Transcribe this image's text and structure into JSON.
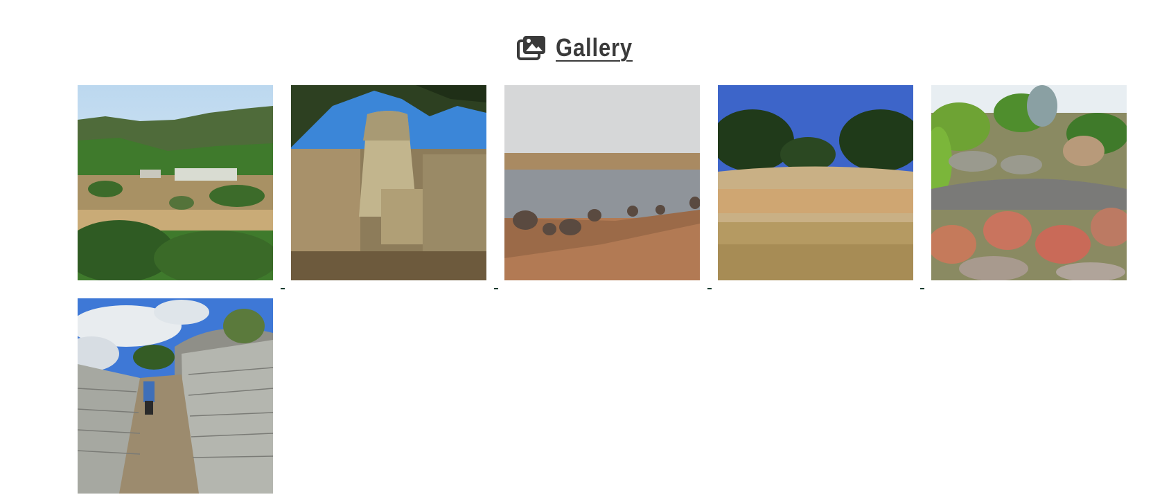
{
  "gallery": {
    "title": "Gallery",
    "icon": "photo-library-icon",
    "items": [
      {
        "icon": "landscape-photo"
      },
      {
        "icon": "tower-photo"
      },
      {
        "icon": "elephants-photo"
      },
      {
        "icon": "wall-photo"
      },
      {
        "icon": "boulders-photo"
      },
      {
        "icon": "stone-passage-photo"
      }
    ]
  },
  "colors": {
    "heading": "#3a3a3a",
    "link_marker": "#0d3b2e"
  }
}
